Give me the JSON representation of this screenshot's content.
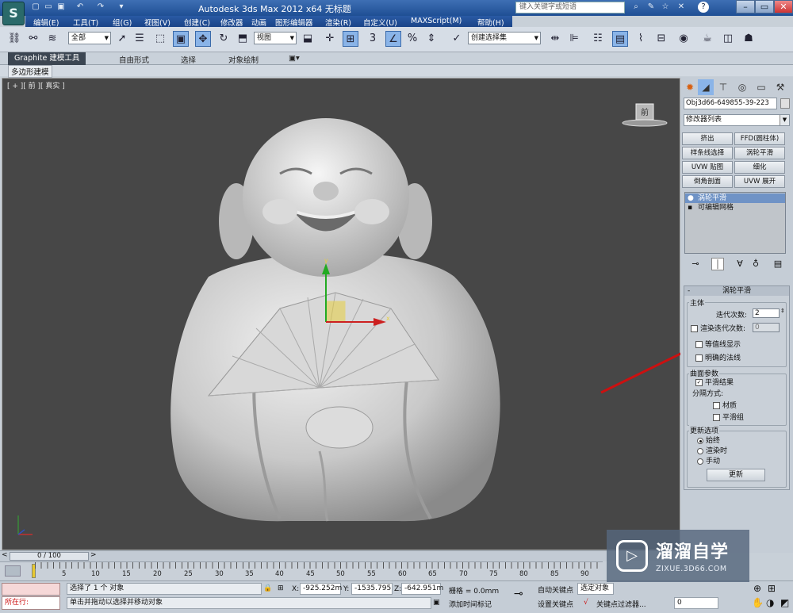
{
  "app": {
    "title": "Autodesk 3ds Max  2012 x64      无标题",
    "icon_glyph": "S",
    "search_placeholder": "键入关键字或短语"
  },
  "quick_access": [
    "new-icon",
    "open-icon",
    "save-icon",
    "undo-icon",
    "redo-icon",
    "dropdown-icon"
  ],
  "menu": [
    "编辑(E)",
    "工具(T)",
    "组(G)",
    "视图(V)",
    "创建(C)",
    "修改器",
    "动画",
    "图形编辑器",
    "渲染(R)",
    "自定义(U)",
    "MAXScript(M)",
    "帮助(H)"
  ],
  "toolbar": {
    "selection_filter": "全部",
    "reference_coord": "视图",
    "named_selection": "创建选择集",
    "snap_label": "3",
    "percent_label": "%"
  },
  "ribbon": {
    "tabs": [
      "Graphite 建模工具",
      "自由形式",
      "选择",
      "对象绘制"
    ],
    "sub_label": "多边形建模"
  },
  "viewport": {
    "label": "[ + ][ 前 ][ 真实 ]",
    "viewcube_label": "前",
    "gizmo_x": "x",
    "gizmo_y": "y"
  },
  "panel": {
    "object_name": "Obj3d66-649855-39-223",
    "modifier_list": "修改器列表",
    "buttons": [
      "挤出",
      "FFD(圆柱体)",
      "样条线选择",
      "涡轮平滑",
      "UVW 贴图",
      "细化",
      "倒角剖面",
      "UVW 展开"
    ],
    "stack": [
      "涡轮平滑",
      "可编辑网格"
    ],
    "rollout_title": "涡轮平滑",
    "main_group": "主体",
    "iterations_label": "迭代次数:",
    "iterations_value": "2",
    "render_iters_label": "渲染迭代次数:",
    "render_iters_value": "0",
    "isoline_label": "等值线显示",
    "explicit_normals_label": "明确的法线",
    "surface_group": "曲面参数",
    "smooth_result_label": "平滑结果",
    "separate_by_label": "分隔方式:",
    "materials_label": "材质",
    "smoothing_groups_label": "平滑组",
    "update_group": "更新选项",
    "always_label": "始终",
    "when_rendering_label": "渲染时",
    "manually_label": "手动",
    "update_button": "更新"
  },
  "timeline": {
    "slider": "0 / 100",
    "ticks": [
      "5",
      "10",
      "15",
      "20",
      "25",
      "30",
      "35",
      "40",
      "45",
      "50",
      "55",
      "60",
      "65",
      "70",
      "75",
      "80",
      "85",
      "90"
    ]
  },
  "status": {
    "script_label": "所在行:",
    "selected_text": "选择了 1 个 对象",
    "prompt_text": "单击并拖动以选择并移动对象",
    "x_label": "X:",
    "x_value": "-925.252m",
    "y_label": "Y:",
    "y_value": "-1535.795",
    "z_label": "Z:",
    "z_value": "-642.951m",
    "grid_text": "栅格 = 0.0mm",
    "add_tag": "添加时间标记",
    "autokey": "自动关键点",
    "setkey": "设置关键点",
    "selected_obj": "选定对象",
    "key_filters": "关键点过滤器...",
    "frame_value": "0"
  },
  "watermark": {
    "name": "溜溜自学",
    "url": "ZIXUE.3D66.COM"
  },
  "colors": {
    "viewport_bg": "#474747",
    "annotation_red": "#cc1010",
    "gizmo_green": "#22aa22",
    "gizmo_red": "#cc2020",
    "gizmo_yellow": "#e8d040"
  }
}
